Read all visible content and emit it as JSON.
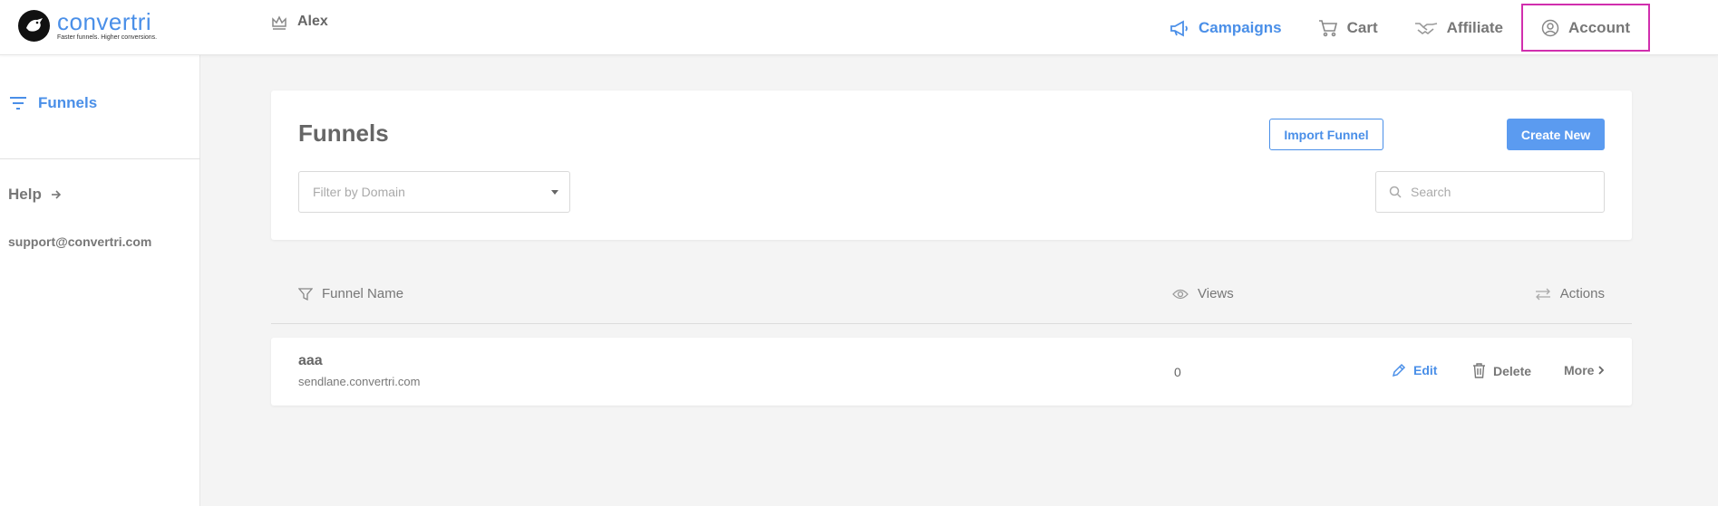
{
  "header": {
    "logo": {
      "name": "convertri",
      "tagline": "Faster funnels. Higher conversions."
    },
    "user": {
      "name": "Alex"
    },
    "nav": [
      {
        "label": "Campaigns",
        "icon": "megaphone-icon",
        "active": true
      },
      {
        "label": "Cart",
        "icon": "cart-icon",
        "active": false
      },
      {
        "label": "Affiliate",
        "icon": "handshake-icon",
        "active": false
      },
      {
        "label": "Account",
        "icon": "user-circle-icon",
        "active": false,
        "highlighted": true
      }
    ],
    "accent_color": "#4a8fe8",
    "highlight_color": "#d12fae"
  },
  "sidebar": {
    "funnels_label": "Funnels",
    "help_label": "Help",
    "support_email": "support@convertri.com"
  },
  "main": {
    "title": "Funnels",
    "import_button": "Import Funnel",
    "create_button": "Create New",
    "domain_filter_placeholder": "Filter by Domain",
    "search_placeholder": "Search"
  },
  "table": {
    "headers": {
      "name": "Funnel Name",
      "views": "Views",
      "actions": "Actions"
    },
    "rows": [
      {
        "title": "aaa",
        "domain": "sendlane.convertri.com",
        "views": "0",
        "edit": "Edit",
        "delete": "Delete",
        "more": "More"
      }
    ]
  }
}
